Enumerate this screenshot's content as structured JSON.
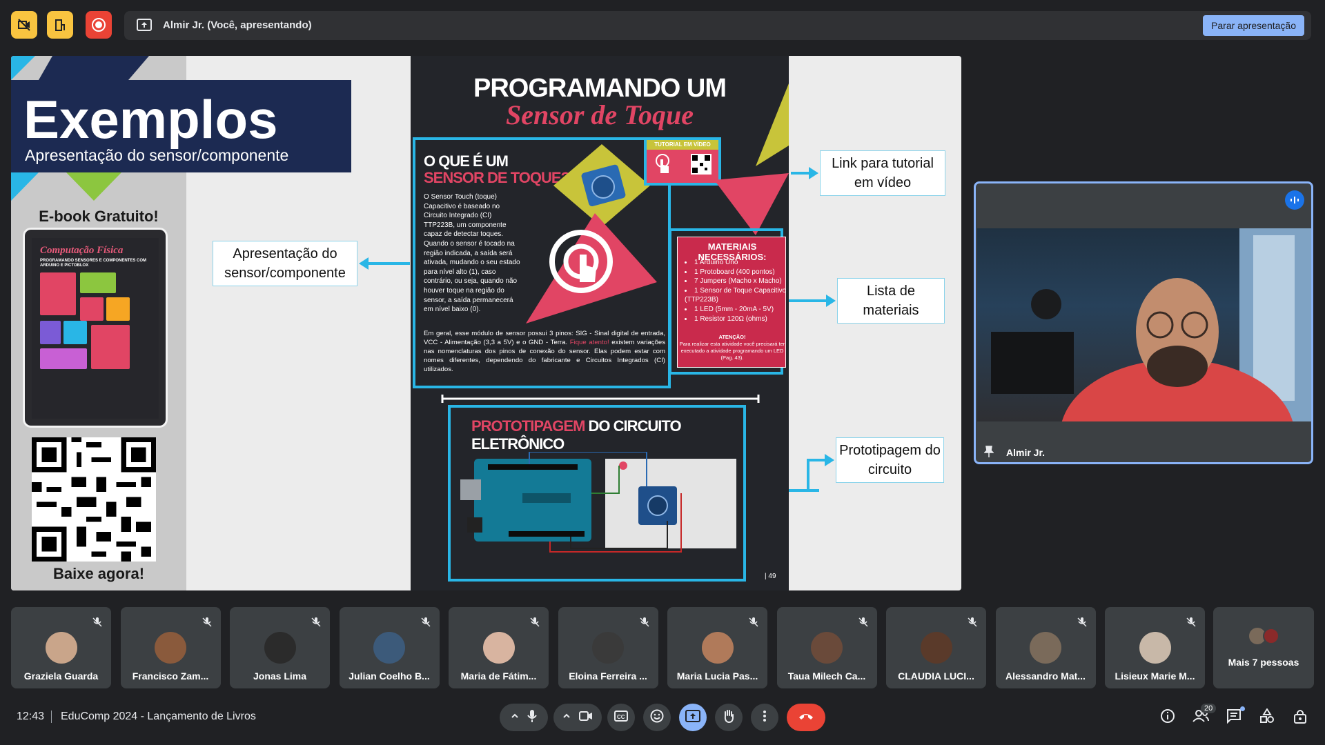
{
  "presenting": {
    "text": "Almir Jr. (Você, apresentando)",
    "stop_button": "Parar apresentação"
  },
  "slide": {
    "title": "Exemplos",
    "subtitle": "Apresentação do sensor/componente",
    "ebook_label": "E-book Gratuito!",
    "ebook_cover_title": "Computação Física",
    "ebook_cover_subtitle": "PROGRAMANDO SENSORES E COMPONENTES COM ARDUINO E PICTOBLOX",
    "download_label": "Baixe agora!",
    "callouts": {
      "presentation": "Apresentação do sensor/componente",
      "tutorial": "Link para tutorial em vídeo",
      "materials": "Lista de materiais",
      "prototype": "Prototipagem do circuito"
    },
    "poster": {
      "heading_1": "PROGRAMANDO UM",
      "heading_2": "Sensor de Toque",
      "what_is_1": "O QUE É UM",
      "what_is_2": "SENSOR DE TOQUE?",
      "what_is_body": "O Sensor Touch (toque) Capacitivo é baseado no Circuito Integrado (CI) TTP223B, um componente capaz de detectar toques. Quando o sensor é tocado na região indicada, a saída será ativada, mudando o seu estado para nível alto (1), caso contrário, ou seja, quando não houver toque na região do sensor, a saída permanecerá em nível baixo (0).",
      "pins_body": "Em geral, esse módulo de sensor possui 3 pinos: SIG - Sinal digital de entrada, VCC - Alimentação (3,3 a 5V) e o GND - Terra.",
      "warning_prefix": "Fique atento!",
      "warning_body": " existem variações nas nomenclaturas dos pinos de conexão do sensor. Elas podem estar com nomes diferentes, dependendo do fabricante e Circuitos Integrados (CI) utilizados.",
      "tutorial_badge": "TUTORIAL EM VÍDEO",
      "materials_title": "MATERIAIS NECESSÁRIOS:",
      "materials": [
        "1 Arduino Uno",
        "1 Protoboard (400 pontos)",
        "7 Jumpers (Macho x Macho)",
        "1 Sensor de Toque Capacitivo (TTP223B)",
        "1 LED (5mm - 20mA - 5V)",
        "1 Resistor 120Ω (ohms)"
      ],
      "attention": "ATENÇÃO!",
      "attention_body": "Para realizar esta atividade você precisará ter executado a atividade programando um LED (Pag. 43).",
      "proto_title_1": "PROTOTIPAGEM",
      "proto_title_2": " DO CIRCUITO ELETRÔNICO",
      "page_number": "| 49"
    }
  },
  "video": {
    "name": "Almir Jr."
  },
  "participants": [
    {
      "name": "Graziela Guarda",
      "color": "#c9a58a"
    },
    {
      "name": "Francisco Zam...",
      "color": "#8a5a3c"
    },
    {
      "name": "Jonas Lima",
      "color": "#2b2b2b"
    },
    {
      "name": "Julian Coelho B...",
      "color": "#3c5a7a"
    },
    {
      "name": "Maria de Fátim...",
      "color": "#d8b4a0"
    },
    {
      "name": "Eloina Ferreira ...",
      "color": "#3a3a3a"
    },
    {
      "name": "Maria Lucia Pas...",
      "color": "#b07a5a"
    },
    {
      "name": "Taua Milech Ca...",
      "color": "#6a4a3a"
    },
    {
      "name": "CLAUDIA LUCI...",
      "color": "#5a3a2a"
    },
    {
      "name": "Alessandro Mat...",
      "color": "#7a6a5a"
    },
    {
      "name": "Lisieux Marie M...",
      "color": "#c8b8a8"
    }
  ],
  "more_people": "Mais 7 pessoas",
  "bottom": {
    "time": "12:43",
    "meeting_title": "EduComp 2024 - Lançamento de Livros",
    "people_count": "20"
  }
}
